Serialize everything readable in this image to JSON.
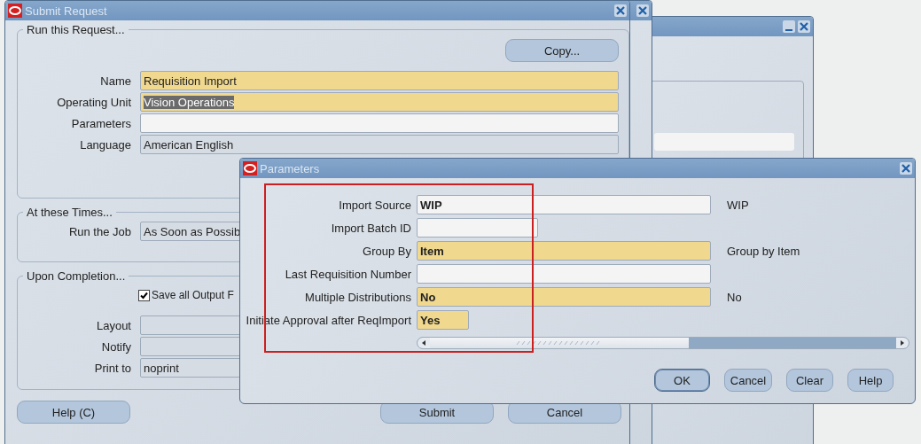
{
  "submit_request": {
    "title": "Submit Request",
    "run_this_request": {
      "legend": "Run this Request...",
      "copy_button": "Copy...",
      "fields": [
        {
          "label": "Name",
          "value": "Requisition Import",
          "kind": "required",
          "highlighted": false
        },
        {
          "label": "Operating Unit",
          "value": "Vision Operations",
          "kind": "required",
          "highlighted": true
        },
        {
          "label": "Parameters",
          "kind": "plain"
        },
        {
          "label": "Language",
          "value": "American English",
          "kind": "readonly",
          "highlighted": false
        }
      ]
    },
    "at_these_times": {
      "legend": "At these Times...",
      "fields": [
        {
          "label": "Run the Job",
          "value": "As Soon as Possib",
          "kind": "readonly",
          "highlighted": false
        }
      ]
    },
    "upon_completion": {
      "legend": "Upon Completion...",
      "checkbox": {
        "label": "Save all Output F",
        "checked": true
      },
      "fields": [
        {
          "label": "Layout",
          "kind": "readonly"
        },
        {
          "label": "Notify",
          "kind": "readonly"
        },
        {
          "label": "Print to",
          "value": "noprint",
          "kind": "readonly",
          "highlighted": false
        }
      ]
    },
    "buttons": [
      {
        "label": "Help (C)"
      },
      {
        "label": "Submit"
      },
      {
        "label": "Cancel"
      }
    ]
  },
  "parameters": {
    "title": "Parameters",
    "rows": [
      {
        "label": "Import Source",
        "value": "WIP",
        "kind": "plain",
        "description": "WIP"
      },
      {
        "label": "Import Batch ID",
        "kind": "plain"
      },
      {
        "label": "Group By",
        "value": "Item",
        "kind": "required",
        "description": "Group by Item"
      },
      {
        "label": "Last Requisition Number",
        "kind": "plain"
      },
      {
        "label": "Multiple Distributions",
        "value": "No",
        "kind": "required",
        "description": "No"
      },
      {
        "label": "Initiate Approval after ReqImport",
        "value": "Yes",
        "kind": "required"
      }
    ],
    "buttons": [
      {
        "label": "OK",
        "default": true
      },
      {
        "label": "Cancel",
        "default": false
      },
      {
        "label": "Clear",
        "default": false
      },
      {
        "label": "Help",
        "default": false
      }
    ]
  }
}
